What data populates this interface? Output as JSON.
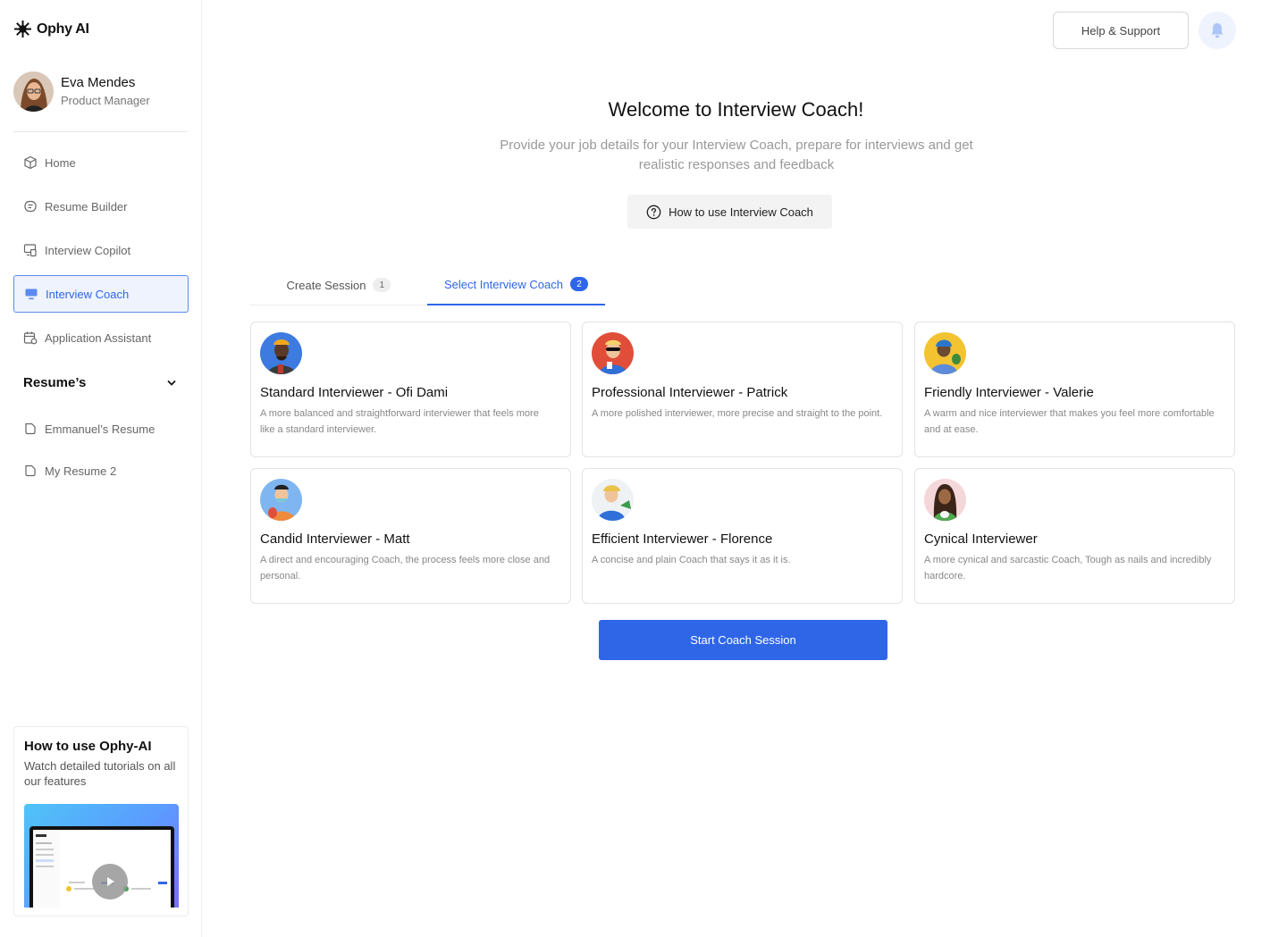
{
  "app": {
    "name": "Ophy AI"
  },
  "user": {
    "name": "Eva Mendes",
    "role": "Product Manager"
  },
  "sidebar": {
    "items": [
      {
        "label": "Home",
        "icon": "cube-icon",
        "active": false
      },
      {
        "label": "Resume Builder",
        "icon": "document-icon",
        "active": false
      },
      {
        "label": "Interview Copilot",
        "icon": "devices-icon",
        "active": false
      },
      {
        "label": "Interview Coach",
        "icon": "monitor-icon",
        "active": true
      },
      {
        "label": "Application Assistant",
        "icon": "calendar-icon",
        "active": false
      }
    ],
    "resumes_section": {
      "title": "Resume’s",
      "items": [
        {
          "label": "Emmanuel’s Resume",
          "icon": "file-icon"
        },
        {
          "label": "My Resume 2",
          "icon": "file-icon"
        }
      ]
    },
    "tutorial": {
      "title": "How to use Ophy-AI",
      "description": "Watch detailed tutorials on all our features"
    }
  },
  "header": {
    "help_label": "Help & Support"
  },
  "main": {
    "title": "Welcome to Interview Coach!",
    "subtitle": "Provide your job details for your Interview Coach, prepare for interviews and get realistic responses and feedback",
    "howto_label": "How to use Interview Coach",
    "tabs": [
      {
        "label": "Create Session",
        "badge": "1",
        "active": false
      },
      {
        "label": "Select Interview Coach",
        "badge": "2",
        "active": true
      }
    ],
    "coaches": [
      {
        "title": "Standard Interviewer - Ofi Dami",
        "description": "A more balanced and straightforward interviewer that feels more like a standard interviewer.",
        "avatar_bg": "#3d7be0"
      },
      {
        "title": "Professional Interviewer - Patrick",
        "description": "A more polished interviewer, more precise and straight to the point.",
        "avatar_bg": "#e04e3a"
      },
      {
        "title": "Friendly Interviewer - Valerie",
        "description": "A warm and nice interviewer that makes you feel more comfortable and at ease.",
        "avatar_bg": "#f3c331"
      },
      {
        "title": "Candid Interviewer - Matt",
        "description": "A direct and encouraging Coach, the process feels more close and personal.",
        "avatar_bg": "#7fb6f2"
      },
      {
        "title": "Efficient Interviewer - Florence",
        "description": "A concise and plain Coach that says it as it is.",
        "avatar_bg": "#eef2f5"
      },
      {
        "title": "Cynical Interviewer",
        "description": "A more cynical and sarcastic Coach, Tough as nails and incredibly hardcore.",
        "avatar_bg": "#f4d7d9"
      }
    ],
    "start_label": "Start Coach Session"
  },
  "colors": {
    "accent": "#2f66e8",
    "active_bg": "#eef3fe"
  }
}
